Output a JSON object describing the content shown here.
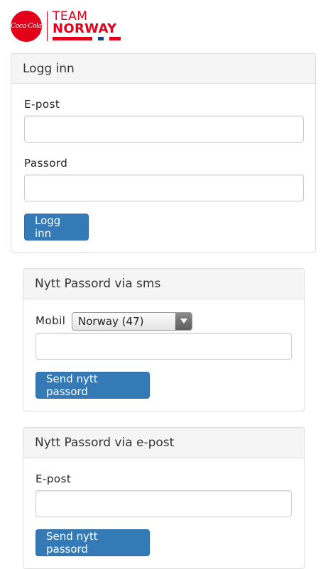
{
  "logo": {
    "brand_text": "Coca-Cola",
    "title_line1": "TEAM",
    "title_line2": "NORWAY",
    "flag_colors": [
      "#e3001b",
      "#ffffff",
      "#1a3a8c",
      "#ffffff",
      "#e3001b"
    ]
  },
  "login_panel": {
    "heading": "Logg inn",
    "email_label": "E-post",
    "email_value": "",
    "password_label": "Passord",
    "password_value": "",
    "submit_label": "Logg inn"
  },
  "sms_panel": {
    "heading": "Nytt Passord via sms",
    "mobile_label": "Mobil",
    "country_selected": "Norway (47)",
    "phone_value": "",
    "submit_label": "Send nytt passord"
  },
  "email_panel": {
    "heading": "Nytt Passord via e-post",
    "email_label": "E-post",
    "email_value": "",
    "submit_label": "Send nytt passord"
  },
  "colors": {
    "brand_red": "#e3001b",
    "primary_button": "#337ab7",
    "panel_heading_bg": "#f5f5f5"
  }
}
